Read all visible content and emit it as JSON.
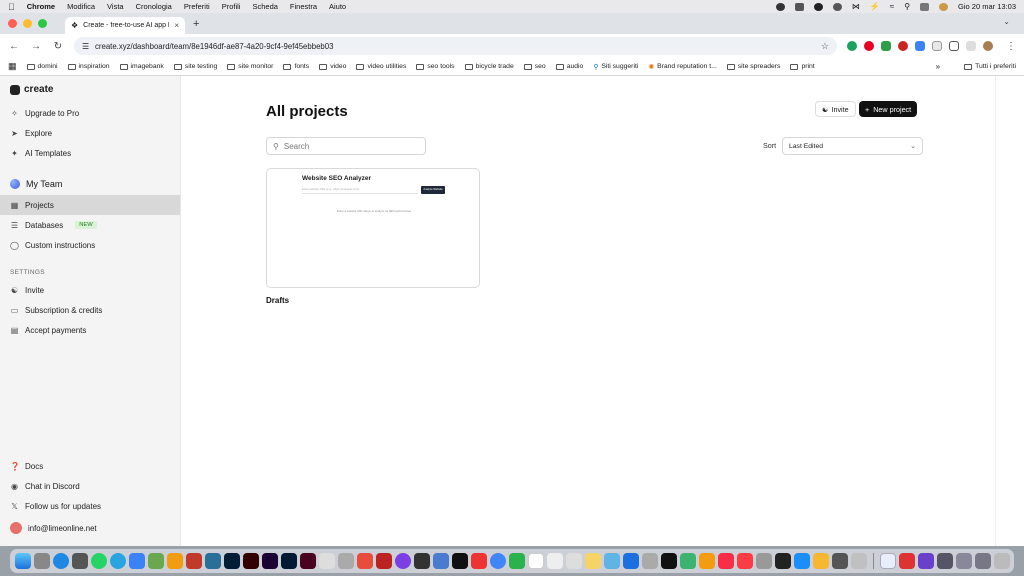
{
  "menubar": {
    "app": "Chrome",
    "items": [
      "Modifica",
      "Vista",
      "Cronologia",
      "Preferiti",
      "Profili",
      "Scheda",
      "Finestra",
      "Aiuto"
    ],
    "clock": "Gio 20 mar  13:03"
  },
  "browser": {
    "tab_title": "Create - free-to-use AI app b",
    "url": "create.xyz/dashboard/team/8e1946df-ae87-4a20-9cf4-9ef45ebbeb03",
    "bookmarks": [
      "domini",
      "inspiration",
      "imagebank",
      "site testing",
      "site monitor",
      "fonts",
      "video",
      "video utilities",
      "seo tools",
      "bicycle trade",
      "seo",
      "audio",
      "Siti suggeriti",
      "Brand reputation t...",
      "site spreaders",
      "print"
    ],
    "bookmarks_more": "»",
    "all_bookmarks": "Tutti i preferiti"
  },
  "sidebar": {
    "brand": "create",
    "top_items": [
      {
        "label": "Upgrade to Pro",
        "icon": "sparkle-icon"
      },
      {
        "label": "Explore",
        "icon": "rocket-icon"
      },
      {
        "label": "AI Templates",
        "icon": "sparkle-icon"
      }
    ],
    "team": "My Team",
    "team_items": [
      {
        "label": "Projects",
        "icon": "grid-icon"
      },
      {
        "label": "Databases",
        "icon": "database-icon",
        "badge": "NEW"
      },
      {
        "label": "Custom instructions",
        "icon": "chat-icon"
      }
    ],
    "settings_label": "SETTINGS",
    "settings_items": [
      {
        "label": "Invite",
        "icon": "user-plus-icon"
      },
      {
        "label": "Subscription & credits",
        "icon": "card-icon"
      },
      {
        "label": "Accept payments",
        "icon": "wallet-icon"
      }
    ],
    "bottom_items": [
      {
        "label": "Docs",
        "icon": "help-icon"
      },
      {
        "label": "Chat in Discord",
        "icon": "discord-icon"
      },
      {
        "label": "Follow us for updates",
        "icon": "x-logo-icon"
      }
    ],
    "user_email": "info@limeonline.net"
  },
  "main": {
    "title": "All projects",
    "invite_label": "Invite",
    "new_project_label": "New project",
    "search_placeholder": "Search",
    "sort_label": "Sort",
    "sort_value": "Last Edited",
    "projects": [
      {
        "preview_title": "Website SEO Analyzer",
        "preview_input": "Enter website URL (e.g., https://example.com)",
        "preview_button": "Analyze Website",
        "preview_desc": "Enter a website URL above to analyze its SEO performance",
        "label": "Drafts"
      }
    ]
  },
  "colors": {
    "accent": "#111111",
    "new_badge_bg": "#d8f3d5",
    "new_badge_fg": "#2d7a2a",
    "active_item_bg": "#d8d8d8"
  }
}
